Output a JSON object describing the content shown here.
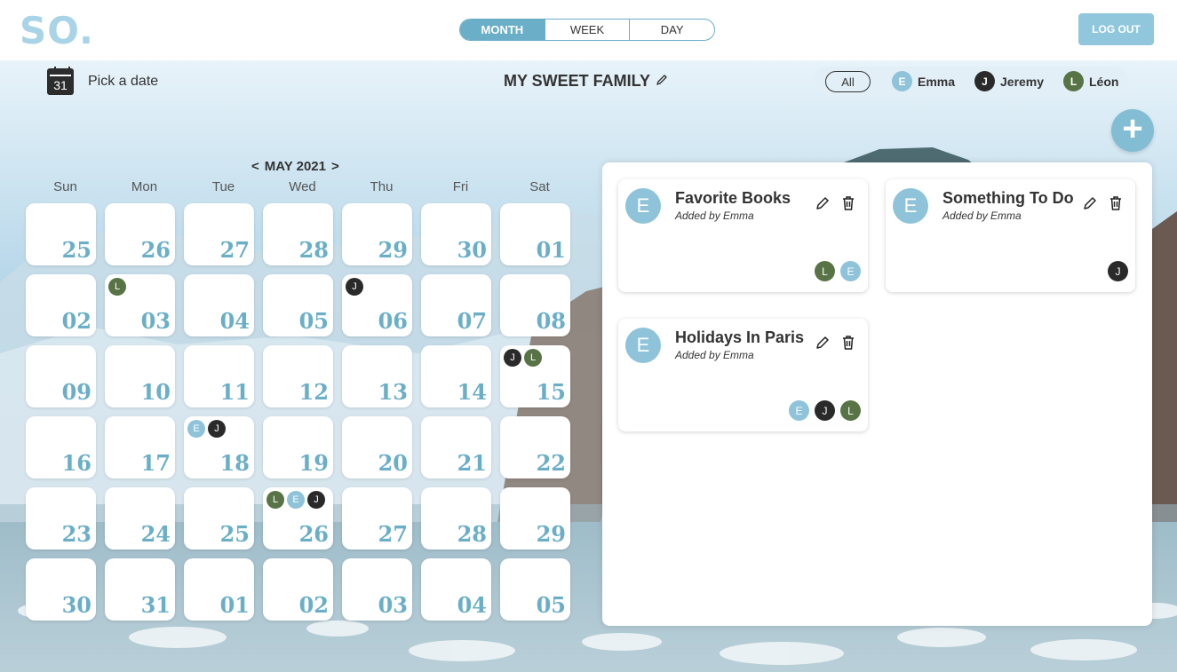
{
  "header": {
    "logo": "SO.",
    "views": [
      "MONTH",
      "WEEK",
      "DAY"
    ],
    "active_view": "MONTH",
    "logout_label": "LOG OUT"
  },
  "toolbar": {
    "calendar_icon_day": "31",
    "pick_date_label": "Pick a date",
    "family_title": "MY SWEET FAMILY",
    "filter_all_label": "All",
    "members": [
      {
        "initial": "E",
        "name": "Emma",
        "color": "#8ec3da"
      },
      {
        "initial": "J",
        "name": "Jeremy",
        "color": "#2a2a2a"
      },
      {
        "initial": "L",
        "name": "Léon",
        "color": "#587446"
      }
    ],
    "add_label": "+"
  },
  "calendar": {
    "month_label": "MAY 2021",
    "prev": "<",
    "next": ">",
    "weekdays": [
      "Sun",
      "Mon",
      "Tue",
      "Wed",
      "Thu",
      "Fri",
      "Sat"
    ],
    "weeks": [
      [
        {
          "d": "25",
          "m": []
        },
        {
          "d": "26",
          "m": []
        },
        {
          "d": "27",
          "m": []
        },
        {
          "d": "28",
          "m": []
        },
        {
          "d": "29",
          "m": []
        },
        {
          "d": "30",
          "m": []
        },
        {
          "d": "01",
          "m": []
        }
      ],
      [
        {
          "d": "02",
          "m": []
        },
        {
          "d": "03",
          "m": [
            "L"
          ]
        },
        {
          "d": "04",
          "m": []
        },
        {
          "d": "05",
          "m": []
        },
        {
          "d": "06",
          "m": [
            "J"
          ]
        },
        {
          "d": "07",
          "m": []
        },
        {
          "d": "08",
          "m": []
        }
      ],
      [
        {
          "d": "09",
          "m": []
        },
        {
          "d": "10",
          "m": []
        },
        {
          "d": "11",
          "m": []
        },
        {
          "d": "12",
          "m": []
        },
        {
          "d": "13",
          "m": []
        },
        {
          "d": "14",
          "m": []
        },
        {
          "d": "15",
          "m": [
            "J",
            "L"
          ]
        }
      ],
      [
        {
          "d": "16",
          "m": []
        },
        {
          "d": "17",
          "m": []
        },
        {
          "d": "18",
          "m": [
            "E",
            "J"
          ]
        },
        {
          "d": "19",
          "m": []
        },
        {
          "d": "20",
          "m": []
        },
        {
          "d": "21",
          "m": []
        },
        {
          "d": "22",
          "m": []
        }
      ],
      [
        {
          "d": "23",
          "m": []
        },
        {
          "d": "24",
          "m": []
        },
        {
          "d": "25",
          "m": []
        },
        {
          "d": "26",
          "m": [
            "L",
            "E",
            "J"
          ]
        },
        {
          "d": "27",
          "m": []
        },
        {
          "d": "28",
          "m": []
        },
        {
          "d": "29",
          "m": []
        }
      ],
      [
        {
          "d": "30",
          "m": []
        },
        {
          "d": "31",
          "m": []
        },
        {
          "d": "01",
          "m": []
        },
        {
          "d": "02",
          "m": []
        },
        {
          "d": "03",
          "m": []
        },
        {
          "d": "04",
          "m": []
        },
        {
          "d": "05",
          "m": []
        }
      ]
    ]
  },
  "events": [
    {
      "author_initial": "E",
      "title": "Favorite Books",
      "subtitle": "Added by Emma",
      "members": [
        "L",
        "E"
      ]
    },
    {
      "author_initial": "E",
      "title": "Something To Do",
      "subtitle": "Added by Emma",
      "members": [
        "J"
      ]
    },
    {
      "author_initial": "E",
      "title": "Holidays In Paris",
      "subtitle": "Added by Emma",
      "members": [
        "E",
        "J",
        "L"
      ]
    }
  ],
  "colors": {
    "accent": "#6aaec8",
    "emma": "#8ec3da",
    "jeremy": "#2a2a2a",
    "leon": "#587446"
  }
}
